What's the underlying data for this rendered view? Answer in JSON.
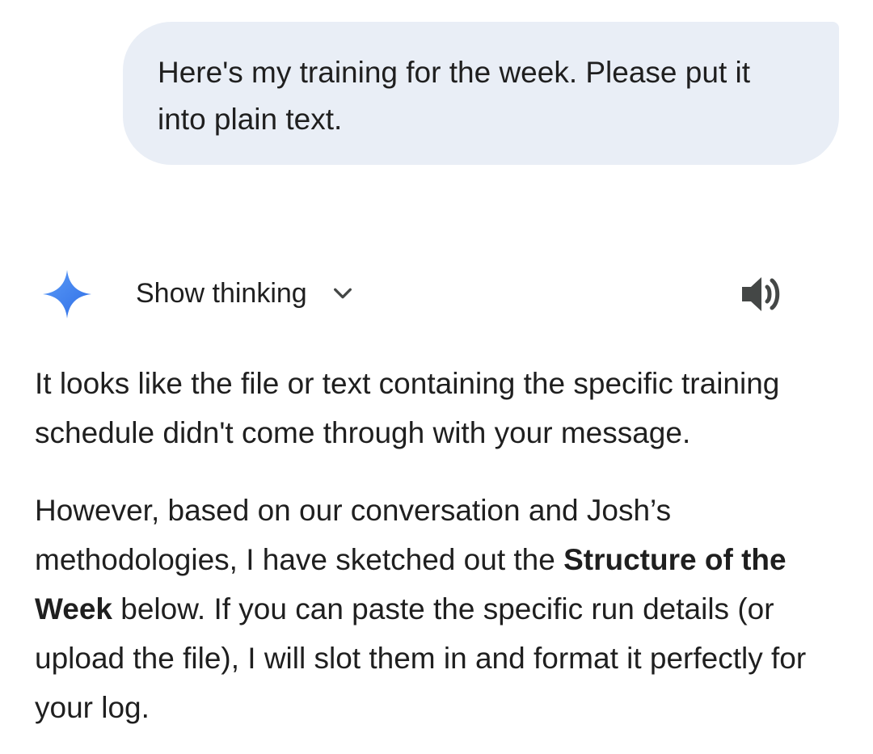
{
  "user_message": {
    "text": "Here's my training for the week. Please put it into plain text."
  },
  "response": {
    "show_thinking_label": "Show thinking",
    "paragraph1": "It looks like the file or text containing the specific training schedule didn't come through with your message.",
    "paragraph2_part1": "However, based on our conversation and Josh’s methodologies, I have sketched out the ",
    "paragraph2_bold": "Structure of the Week",
    "paragraph2_part2": " below. If you can paste the specific run details (or upload the file), I will slot them in and format it perfectly for your log."
  },
  "icons": {
    "assistant": "sparkle-icon",
    "expand": "chevron-down-icon",
    "read_aloud": "speaker-icon"
  },
  "colors": {
    "user_bubble_bg": "#e9eef6",
    "sparkle_start": "#4f8df5",
    "sparkle_end": "#2f6ee6",
    "text": "#1f1f1f",
    "icon": "#444746"
  }
}
